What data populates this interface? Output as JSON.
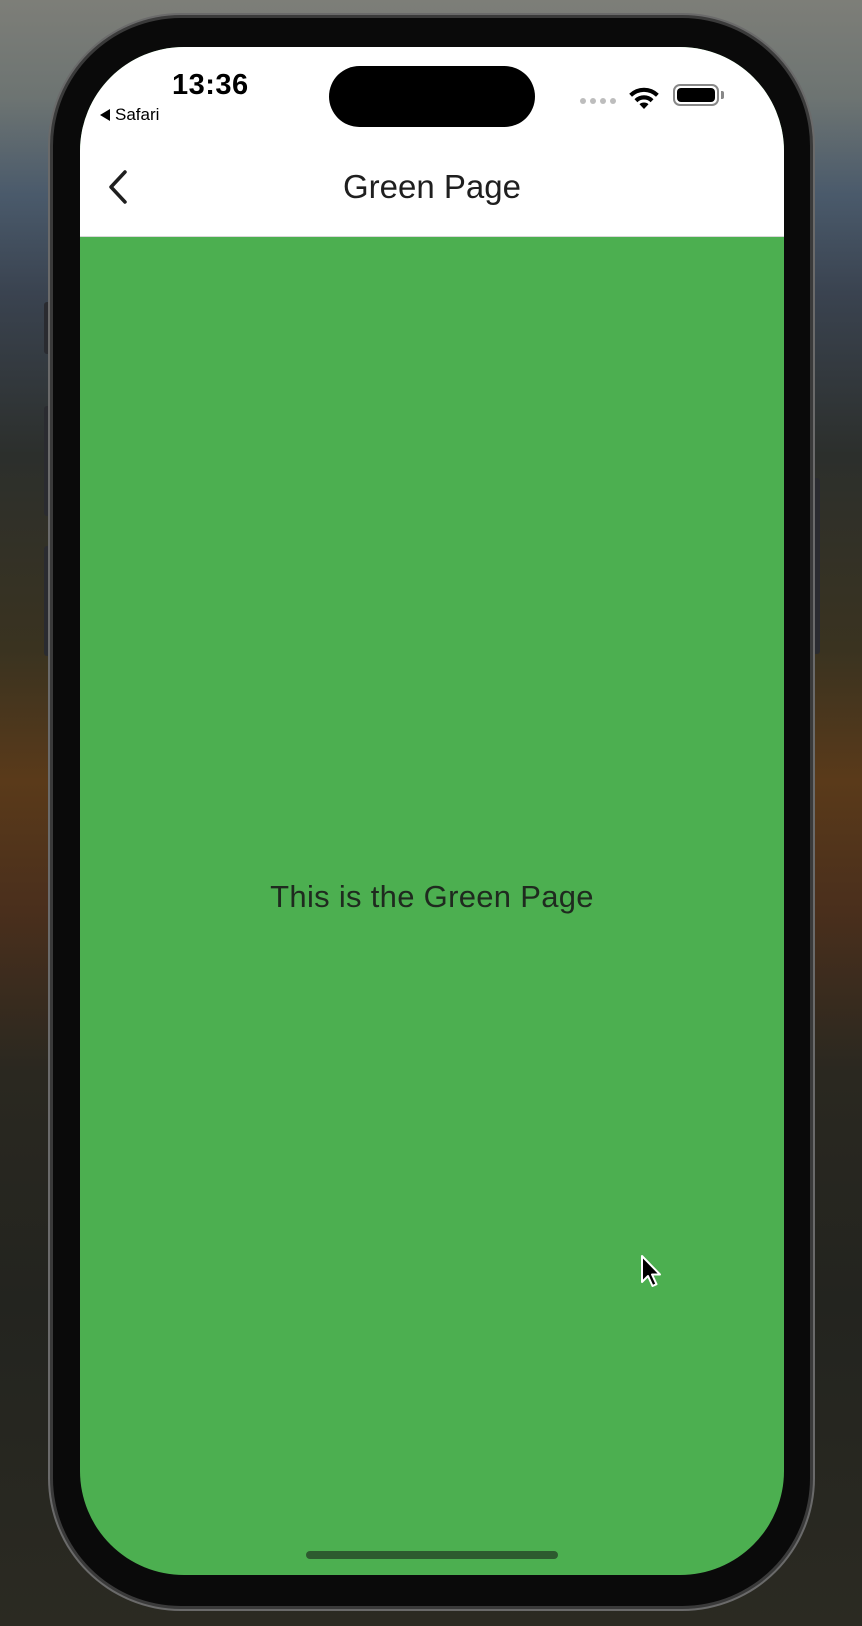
{
  "status_bar": {
    "time": "13:36",
    "back_app_label": "Safari",
    "signal_icon": "cellular-dots-icon",
    "wifi_icon": "wifi-icon",
    "battery_icon": "battery-icon"
  },
  "nav_bar": {
    "title": "Green Page",
    "back_icon": "chevron-left-icon"
  },
  "content": {
    "message": "This is the Green Page",
    "background_color": "#4caf50"
  }
}
